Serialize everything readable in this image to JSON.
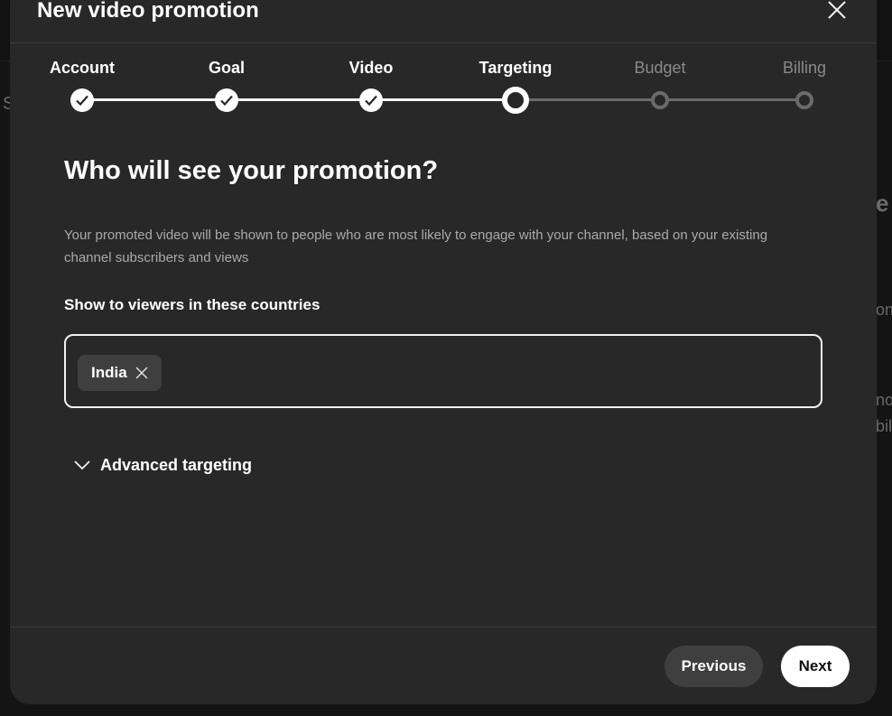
{
  "background": {
    "fragments": [
      "S",
      "e",
      "on",
      "no",
      "bili"
    ]
  },
  "dialog": {
    "title": "New video promotion",
    "close_icon": "close-icon"
  },
  "stepper": {
    "steps": [
      {
        "label": "Account",
        "state": "done"
      },
      {
        "label": "Goal",
        "state": "done"
      },
      {
        "label": "Video",
        "state": "done"
      },
      {
        "label": "Targeting",
        "state": "current"
      },
      {
        "label": "Budget",
        "state": "todo"
      },
      {
        "label": "Billing",
        "state": "todo"
      }
    ]
  },
  "content": {
    "heading": "Who will see your promotion?",
    "description": "Your promoted video will be shown to people who are most likely to engage with your channel, based on your existing channel subscribers and views",
    "countries_label": "Show to viewers in these countries",
    "countries": [
      {
        "label": "India"
      }
    ],
    "advanced_targeting_label": "Advanced targeting"
  },
  "footer": {
    "previous_label": "Previous",
    "next_label": "Next"
  },
  "colors": {
    "dialog_bg": "#282828",
    "active": "#ffffff",
    "inactive": "#6a6a6a"
  }
}
